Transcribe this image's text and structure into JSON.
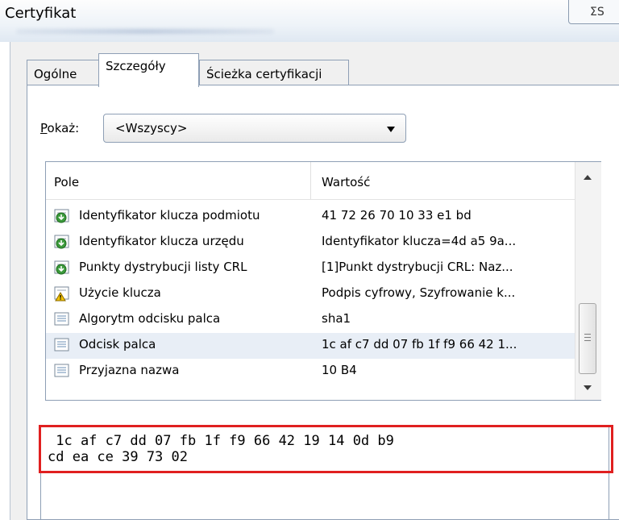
{
  "window": {
    "title": "Certyfikat",
    "close_glyph": "ΣS"
  },
  "tabs": [
    {
      "label": "Ogólne"
    },
    {
      "label": "Szczegóły"
    },
    {
      "label": "Ścieżka certyfikacji"
    }
  ],
  "show": {
    "label_prefix": "P",
    "label_rest": "okaż:",
    "selected": "<Wszyscy>"
  },
  "list": {
    "columns": [
      "Pole",
      "Wartość"
    ],
    "rows": [
      {
        "field": "Identyfikator klucza podmiotu",
        "value": "41 72 26 70 10 33 e1 bd",
        "icon": "cert-extension-icon"
      },
      {
        "field": "Identyfikator klucza urzędu",
        "value": "Identyfikator klucza=4d a5 9a...",
        "icon": "cert-extension-icon"
      },
      {
        "field": "Punkty dystrybucji listy CRL",
        "value": "[1]Punkt dystrybucji CRL: Naz...",
        "icon": "cert-extension-icon"
      },
      {
        "field": "Użycie klucza",
        "value": "Podpis cyfrowy, Szyfrowanie k...",
        "icon": "critical-extension-icon"
      },
      {
        "field": "Algorytm odcisku palca",
        "value": "sha1",
        "icon": "property-icon"
      },
      {
        "field": "Odcisk palca",
        "value": "1c af c7 dd 07 fb 1f f9 66 42 1...",
        "icon": "property-icon"
      },
      {
        "field": "Przyjazna nazwa",
        "value": "10   B4",
        "icon": "property-icon"
      }
    ]
  },
  "detail": {
    "line1": " 1c af c7 dd 07 fb 1f f9 66 42 19 14 0d b9",
    "line2": "cd ea ce 39 73 02"
  },
  "colors": {
    "highlight_frame": "#e02020",
    "selected_row": "#e8eef6"
  }
}
